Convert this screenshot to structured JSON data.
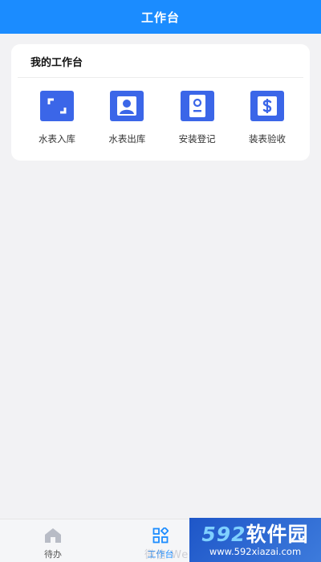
{
  "header": {
    "title": "工作台"
  },
  "card": {
    "title": "我的工作台",
    "items": [
      {
        "label": "水表入库",
        "icon": "scan-frame-icon"
      },
      {
        "label": "水表出库",
        "icon": "user-badge-icon"
      },
      {
        "label": "安装登记",
        "icon": "id-card-icon"
      },
      {
        "label": "装表验收",
        "icon": "dollar-icon"
      }
    ]
  },
  "tabbar": {
    "tabs": [
      {
        "label": "待办",
        "icon": "home-icon",
        "active": false
      },
      {
        "label": "工作台",
        "icon": "grid-icon",
        "active": true
      }
    ]
  },
  "watermark": {
    "brand_num": "592",
    "brand_text": "软件园",
    "url": "www.592xiazai.com",
    "faint": "微信 WeChat"
  },
  "colors": {
    "primary": "#1b8cff",
    "tile": "#3b66e8",
    "background": "#f2f2f4"
  }
}
